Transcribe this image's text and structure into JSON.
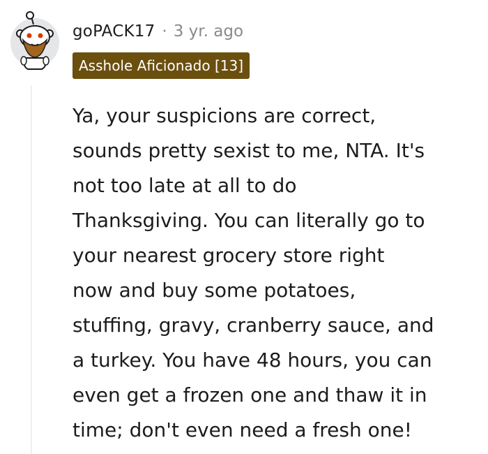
{
  "comment": {
    "username": "goPACK17",
    "separator": "·",
    "timestamp": "3 yr. ago",
    "flair": "Asshole Aficionado [13]",
    "body_lines": [
      "Ya, your suspicions are correct,",
      "sounds pretty sexist to me, NTA. It's",
      "not too late at all to do",
      "Thanksgiving. You can literally go to",
      "your nearest grocery store right",
      "now and buy some potatoes,",
      "stuffing, gravy, cranberry sauce, and",
      "a turkey. You have 48 hours, you can",
      "even get a frozen one and thaw it in",
      "time; don't even need a fresh one!"
    ]
  },
  "avatar": {
    "icon": "snoo-avatar-icon"
  },
  "colors": {
    "flair_background": "#6b4f0f",
    "flair_text": "#ffffff",
    "metadata_text": "#878a8c",
    "body_text": "#1c1c1c",
    "thread_line": "#edeff1"
  }
}
